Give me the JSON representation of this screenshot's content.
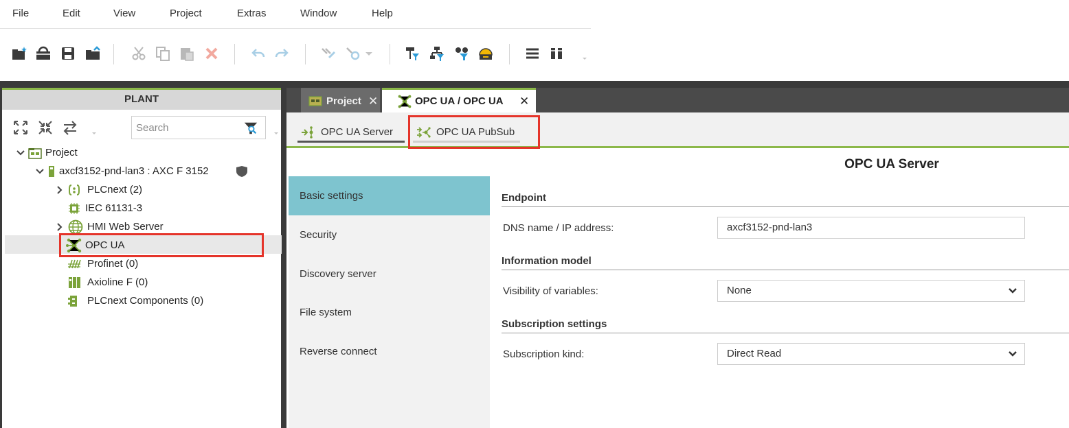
{
  "menu": [
    "File",
    "Edit",
    "View",
    "Project",
    "Extras",
    "Window",
    "Help"
  ],
  "plant": {
    "header": "PLANT",
    "search_placeholder": "Search",
    "tree": [
      {
        "label": "Project"
      },
      {
        "label": "axcf3152-pnd-lan3 : AXC F 3152"
      },
      {
        "label": "PLCnext (2)"
      },
      {
        "label": "IEC 61131-3"
      },
      {
        "label": "HMI Web Server"
      },
      {
        "label": "OPC UA"
      },
      {
        "label": "Profinet (0)"
      },
      {
        "label": "Axioline F (0)"
      },
      {
        "label": "PLCnext Components (0)"
      }
    ]
  },
  "tabs": [
    {
      "label": "Project",
      "close": "✕"
    },
    {
      "label": "OPC UA / OPC UA",
      "close": "✕"
    }
  ],
  "subtabs": [
    "OPC UA Server",
    "OPC UA PubSub"
  ],
  "server": {
    "title": "OPC UA Server",
    "nav": [
      "Basic settings",
      "Security",
      "Discovery server",
      "File system",
      "Reverse connect"
    ],
    "sections": {
      "endpoint": "Endpoint",
      "info_model": "Information model",
      "subscription": "Subscription settings"
    },
    "fields": {
      "dns_label": "DNS name / IP address:",
      "dns_value": "axcf3152-pnd-lan3",
      "visibility_label": "Visibility of variables:",
      "visibility_value": "None",
      "sub_kind_label": "Subscription kind:",
      "sub_kind_value": "Direct Read"
    }
  },
  "colors": {
    "accent_green": "#8cb84a",
    "highlight_red": "#e5342a",
    "active_nav": "#7ec4cf"
  }
}
